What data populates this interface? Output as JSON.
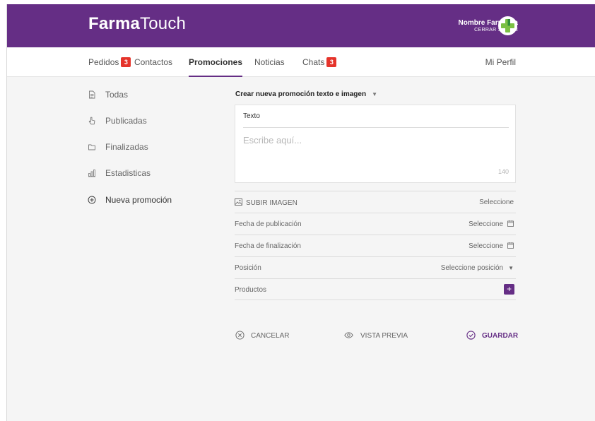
{
  "header": {
    "brand_bold": "Farma",
    "brand_light": "Touch",
    "user_name": "Nombre Farmacia",
    "logout_label": "CERRAR SESIÓN",
    "brand_color": "#652e85",
    "logo_icon": "green-cross-icon",
    "logo_color": "#7bc043"
  },
  "nav": {
    "items": [
      {
        "label": "Pedidos",
        "badge": "3"
      },
      {
        "label": "Contactos"
      },
      {
        "label": "Promociones",
        "active": true
      },
      {
        "label": "Noticias"
      },
      {
        "label": "Chats",
        "badge": "3"
      }
    ],
    "profile_label": "Mi Perfil",
    "badge_color": "#e5342b"
  },
  "sidebar": {
    "items": [
      {
        "label": "Todas",
        "icon": "document-icon"
      },
      {
        "label": "Publicadas",
        "icon": "hand-pointer-icon"
      },
      {
        "label": "Finalizadas",
        "icon": "folder-icon"
      },
      {
        "label": "Estadisticas",
        "icon": "bar-chart-icon"
      },
      {
        "label": "Nueva promoción",
        "icon": "plus-circle-icon"
      }
    ]
  },
  "form": {
    "title": "Crear nueva promoción texto e imagen",
    "title_caret": "▼",
    "text_label": "Texto",
    "text_placeholder": "Escribe aquí...",
    "text_counter": "140",
    "rows": [
      {
        "label": "SUBIR IMAGEN",
        "value": "Seleccione",
        "icon": "image-icon"
      },
      {
        "label": "Fecha de publicación",
        "value": "Seleccione",
        "icon": "calendar-icon"
      },
      {
        "label": "Fecha de finalización",
        "value": "Seleccione",
        "icon": "calendar-icon"
      },
      {
        "label": "Posición",
        "value": "Seleccione posición",
        "icon": "caret-down-icon",
        "caret": "▼"
      },
      {
        "label": "Productos",
        "icon": "plus-icon",
        "button_glyph": "+"
      }
    ]
  },
  "actions": {
    "cancel": "CANCELAR",
    "preview": "VISTA PREVIA",
    "save": "GUARDAR"
  }
}
